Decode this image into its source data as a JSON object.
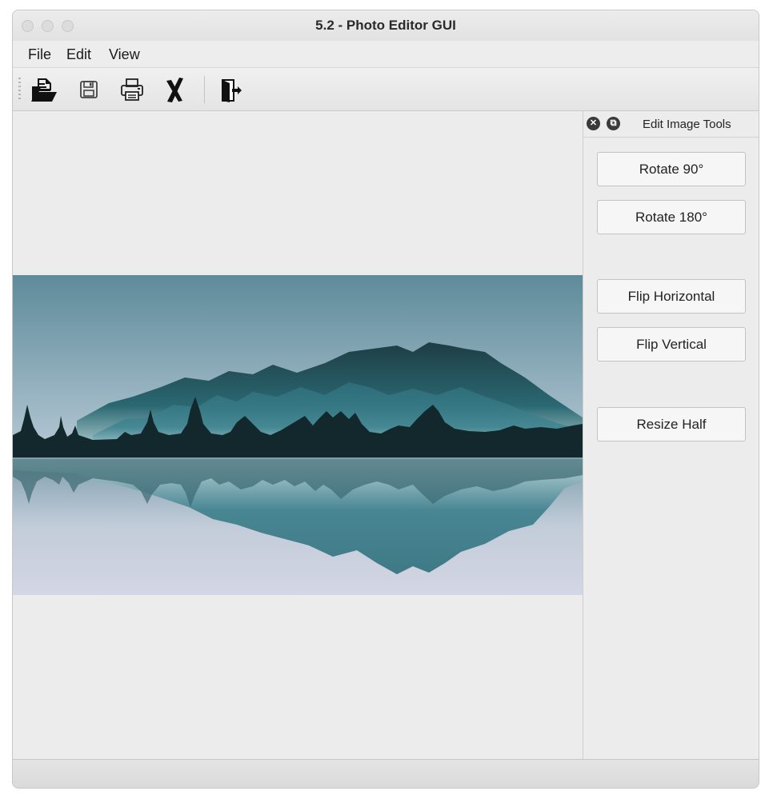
{
  "window": {
    "title": "5.2 - Photo Editor GUI"
  },
  "menubar": {
    "items": [
      {
        "label": "File"
      },
      {
        "label": "Edit"
      },
      {
        "label": "View"
      }
    ]
  },
  "toolbar": {
    "buttons": [
      {
        "icon": "open-folder-icon"
      },
      {
        "icon": "save-icon"
      },
      {
        "icon": "print-icon"
      },
      {
        "icon": "clear-icon"
      },
      {
        "icon": "exit-icon"
      }
    ]
  },
  "image": {
    "description": "mountain-lake-reflection",
    "colors": {
      "sky_top": "#5e8b9a",
      "sky_bottom": "#b7c9d6",
      "mountain": "#2f6f7c",
      "mountain_dark": "#1f3d44",
      "treeline": "#13282c",
      "water_top": "#7c9caa",
      "water_bottom": "#d4d6e4"
    }
  },
  "dock": {
    "title": "Edit Image Tools",
    "buttons": [
      {
        "label": "Rotate 90°"
      },
      {
        "label": "Rotate 180°"
      },
      {
        "label": "Flip Horizontal"
      },
      {
        "label": "Flip Vertical"
      },
      {
        "label": "Resize Half"
      }
    ]
  }
}
